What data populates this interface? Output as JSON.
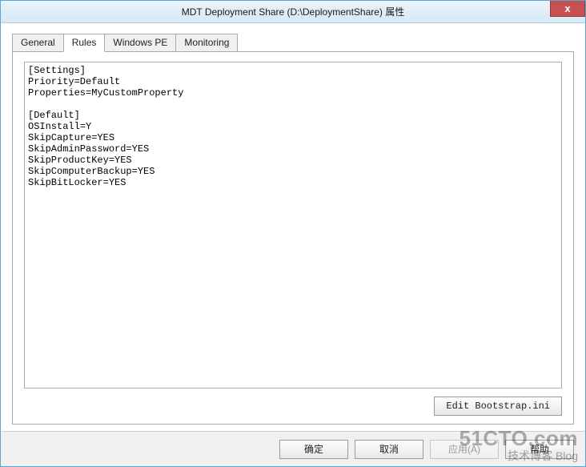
{
  "titlebar": {
    "title": "MDT Deployment Share (D:\\DeploymentShare) 属性",
    "close_glyph": "x"
  },
  "tabs": [
    {
      "label": "General",
      "selected": false
    },
    {
      "label": "Rules",
      "selected": true
    },
    {
      "label": "Windows PE",
      "selected": false
    },
    {
      "label": "Monitoring",
      "selected": false
    }
  ],
  "rules_text": "[Settings]\nPriority=Default\nProperties=MyCustomProperty\n\n[Default]\nOSInstall=Y\nSkipCapture=YES\nSkipAdminPassword=YES\nSkipProductKey=YES\nSkipComputerBackup=YES\nSkipBitLocker=YES\n",
  "panel_buttons": {
    "edit_bootstrap": "Edit Bootstrap.ini"
  },
  "dialog_buttons": {
    "ok": "确定",
    "cancel": "取消",
    "apply": "应用(A)",
    "help": "帮助"
  },
  "watermark": {
    "line1": "51CTO.com",
    "line2": "技术博客 Blog"
  }
}
